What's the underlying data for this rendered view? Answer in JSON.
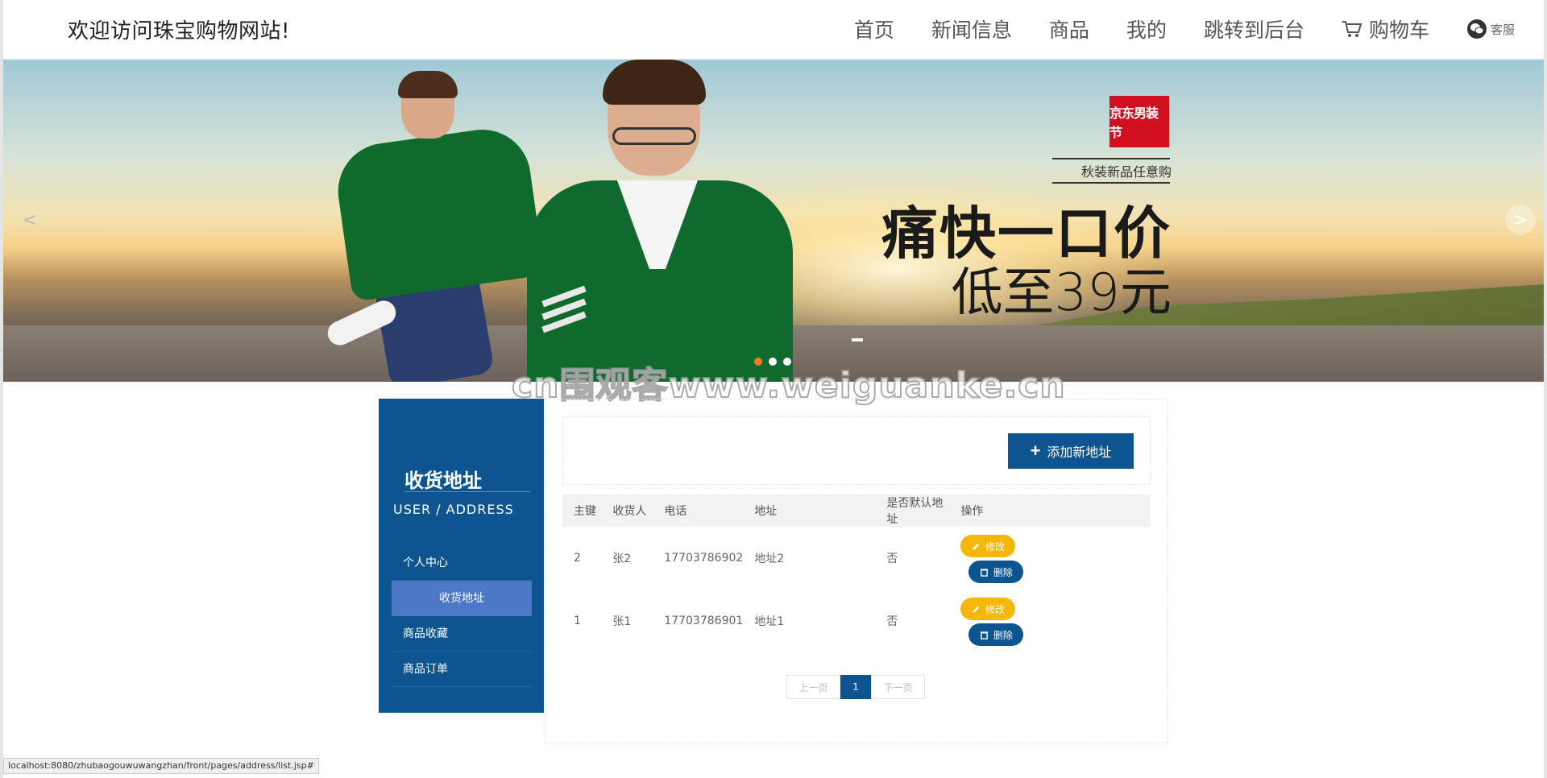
{
  "header": {
    "site_title": "欢迎访问珠宝购物网站!",
    "nav": [
      "首页",
      "新闻信息",
      "商品",
      "我的",
      "跳转到后台"
    ],
    "cart_label": "购物车",
    "kefu_label": "客服"
  },
  "banner": {
    "brand": "京东男装节",
    "subtitle": "秋装新品任意购",
    "headline": "痛快一口价",
    "price_line": "低至39元",
    "prev_arrow": "<",
    "next_arrow": ">",
    "active_dot": 0,
    "dot_count": 3,
    "watermark": "cn围观客www.weiguanke.cn"
  },
  "sidebar": {
    "title": "收货地址",
    "subtitle": "USER / ADDRESS",
    "items": [
      "个人中心",
      "收货地址",
      "商品收藏",
      "商品订单"
    ],
    "active": "收货地址"
  },
  "toolbar": {
    "add_label": "添加新地址"
  },
  "table": {
    "headers": [
      "主键",
      "收货人",
      "电话",
      "地址",
      "是否默认地址",
      "操作"
    ],
    "rows": [
      {
        "id": "2",
        "name": "张2",
        "phone": "17703786902",
        "address": "地址2",
        "default": "否"
      },
      {
        "id": "1",
        "name": "张1",
        "phone": "17703786901",
        "address": "地址1",
        "default": "否"
      }
    ],
    "edit_label": "修改",
    "delete_label": "删除"
  },
  "pager": {
    "prev": "上一页",
    "current": "1",
    "next": "下一页"
  },
  "status_url": "localhost:8080/zhubaogouwuwangzhan/front/pages/address/list.jsp#",
  "colors": {
    "primary": "#0d5591",
    "active_menu": "#4b79c8",
    "edit": "#f5b70a",
    "dot_active": "#f37b1d"
  }
}
